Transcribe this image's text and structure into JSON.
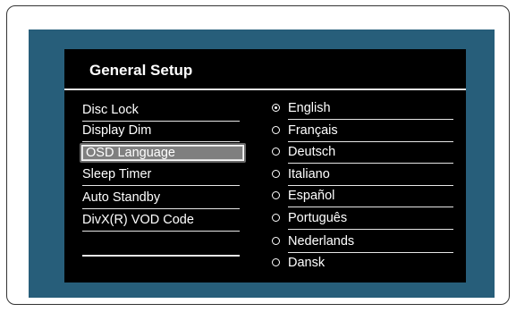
{
  "menu": {
    "title": "General Setup",
    "items": [
      {
        "label": "Disc Lock"
      },
      {
        "label": "Display Dim"
      },
      {
        "label": "OSD Language"
      },
      {
        "label": "Sleep Timer"
      },
      {
        "label": "Auto Standby"
      },
      {
        "label": "DivX(R) VOD Code"
      }
    ],
    "selected_item": "OSD Language"
  },
  "languages": {
    "options": [
      {
        "label": "English"
      },
      {
        "label": "Français"
      },
      {
        "label": "Deutsch"
      },
      {
        "label": "Italiano"
      },
      {
        "label": "Español"
      },
      {
        "label": "Português"
      },
      {
        "label": "Nederlands"
      },
      {
        "label": "Dansk"
      }
    ],
    "selected": "English"
  },
  "colors": {
    "tv_border": "#275e7a",
    "screen_bg": "#000000",
    "highlight": "#7f7f7f",
    "text": "#ffffff"
  }
}
